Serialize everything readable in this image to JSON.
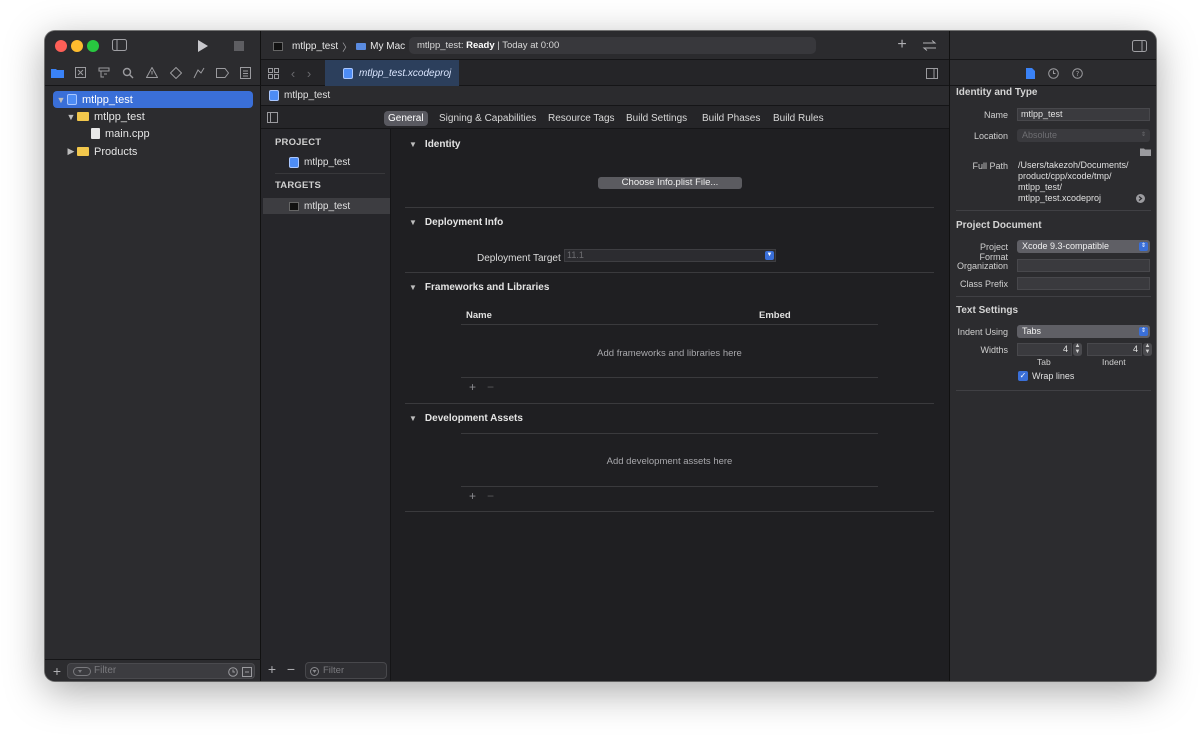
{
  "navigator": {
    "tree": [
      {
        "label": "mtlpp_test",
        "level": 0,
        "kind": "project",
        "selected": true
      },
      {
        "label": "mtlpp_test",
        "level": 1,
        "kind": "folder"
      },
      {
        "label": "main.cpp",
        "level": 2,
        "kind": "file"
      },
      {
        "label": "Products",
        "level": 1,
        "kind": "folder"
      }
    ],
    "filter_placeholder": "Filter"
  },
  "toolbar": {
    "scheme": "mtlpp_test",
    "destination": "My Mac",
    "status_prefix": "mtlpp_test: ",
    "status_state": "Ready",
    "status_time": "Today at 0:00"
  },
  "editor_tab": {
    "label": "mtlpp_test.xcodeproj"
  },
  "jumpbar": {
    "label": "mtlpp_test"
  },
  "segments": [
    "General",
    "Signing & Capabilities",
    "Resource Tags",
    "Build Settings",
    "Build Phases",
    "Build Rules"
  ],
  "targets_list": {
    "project_header": "PROJECT",
    "project_item": "mtlpp_test",
    "targets_header": "TARGETS",
    "target_item": "mtlpp_test",
    "filter_placeholder": "Filter"
  },
  "sections": {
    "identity": {
      "title": "Identity",
      "button": "Choose Info.plist File..."
    },
    "deployment": {
      "title": "Deployment Info",
      "target_label": "Deployment Target",
      "target_value": "11.1"
    },
    "frameworks": {
      "title": "Frameworks and Libraries",
      "col_name": "Name",
      "col_embed": "Embed",
      "placeholder": "Add frameworks and libraries here"
    },
    "dev_assets": {
      "title": "Development Assets",
      "placeholder": "Add development assets here"
    }
  },
  "inspector": {
    "identity_header": "Identity and Type",
    "name_label": "Name",
    "name_value": "mtlpp_test",
    "location_label": "Location",
    "location_value": "Absolute",
    "fullpath_label": "Full Path",
    "fullpath_lines": [
      "/Users/takezoh/Documents/",
      "product/cpp/xcode/tmp/",
      "mtlpp_test/",
      "mtlpp_test.xcodeproj"
    ],
    "project_doc_header": "Project Document",
    "format_label": "Project Format",
    "format_value": "Xcode 9.3-compatible",
    "org_label": "Organization",
    "prefix_label": "Class Prefix",
    "text_header": "Text Settings",
    "indent_label": "Indent Using",
    "indent_value": "Tabs",
    "widths_label": "Widths",
    "tab_width": "4",
    "indent_width": "4",
    "tab_caption": "Tab",
    "indent_caption": "Indent",
    "wrap_label": "Wrap lines",
    "wrap_checked": true
  },
  "colors": {
    "accent": "#3a6fd8",
    "window_bg": "#1f1f22",
    "panel_bg": "#2c2c2f"
  }
}
